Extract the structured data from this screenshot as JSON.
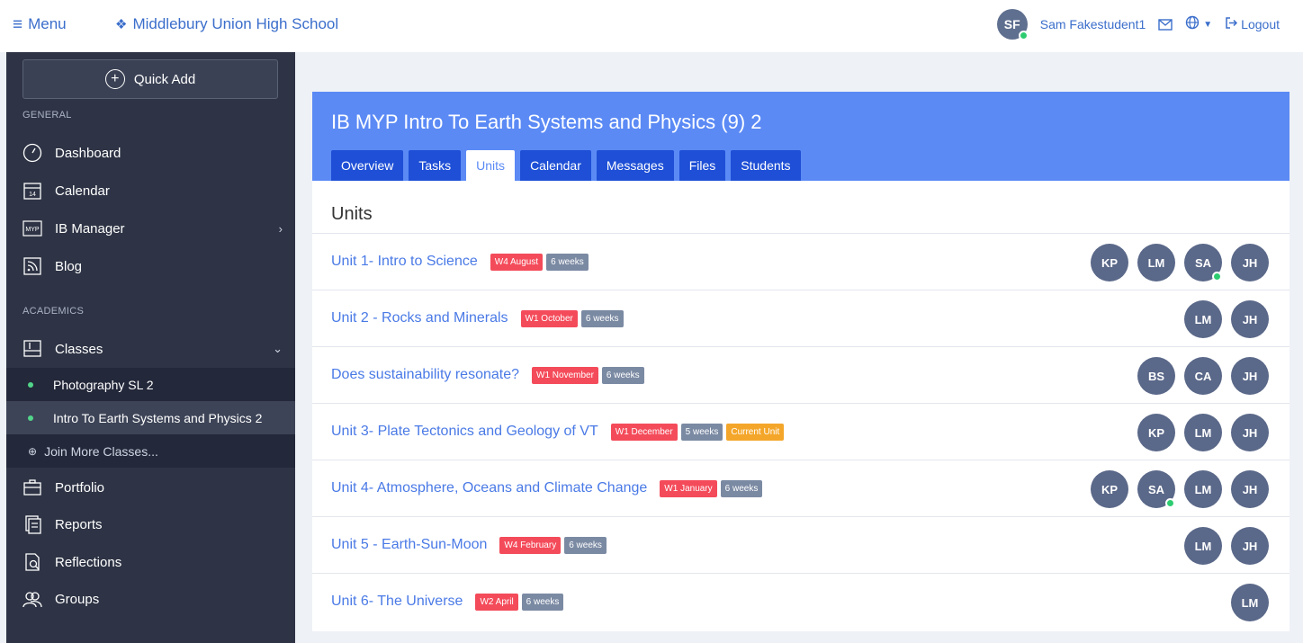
{
  "topbar": {
    "menu_label": "Menu",
    "school_name": "Middlebury Union High School",
    "user_initials": "SF",
    "user_name": "Sam Fakestudent1",
    "logout_label": "Logout"
  },
  "sidebar": {
    "quick_add_label": "Quick Add",
    "general_label": "GENERAL",
    "academics_label": "ACADEMICS",
    "items": {
      "dashboard": "Dashboard",
      "calendar": "Calendar",
      "calendar_icon_num": "14",
      "ib_manager": "IB Manager",
      "ib_icon_text": "MYP",
      "blog": "Blog",
      "classes": "Classes",
      "portfolio": "Portfolio",
      "reports": "Reports",
      "reflections": "Reflections",
      "groups": "Groups"
    },
    "classes": [
      "Photography SL 2",
      "Intro To Earth Systems and Physics 2"
    ],
    "join_label": "Join More Classes..."
  },
  "course": {
    "title": "IB MYP Intro To Earth Systems and Physics (9) 2",
    "tabs": [
      "Overview",
      "Tasks",
      "Units",
      "Calendar",
      "Messages",
      "Files",
      "Students"
    ],
    "active_tab": "Units",
    "units_heading": "Units"
  },
  "units": [
    {
      "title": "Unit 1- Intro to Science",
      "date": "W4 August",
      "weeks": "6 weeks",
      "current": "",
      "people": [
        {
          "i": "KP",
          "online": false
        },
        {
          "i": "LM",
          "online": false
        },
        {
          "i": "SA",
          "online": true
        },
        {
          "i": "JH",
          "online": false
        }
      ]
    },
    {
      "title": "Unit 2 - Rocks and Minerals",
      "date": "W1 October",
      "weeks": "6 weeks",
      "current": "",
      "people": [
        {
          "i": "LM",
          "online": false
        },
        {
          "i": "JH",
          "online": false
        }
      ]
    },
    {
      "title": "Does sustainability resonate?",
      "date": "W1 November",
      "weeks": "6 weeks",
      "current": "",
      "people": [
        {
          "i": "BS",
          "online": false
        },
        {
          "i": "CA",
          "online": false
        },
        {
          "i": "JH",
          "online": false
        }
      ]
    },
    {
      "title": "Unit 3- Plate Tectonics and Geology of VT",
      "date": "W1 December",
      "weeks": "5 weeks",
      "current": "Current Unit",
      "people": [
        {
          "i": "KP",
          "online": false
        },
        {
          "i": "LM",
          "online": false
        },
        {
          "i": "JH",
          "online": false
        }
      ]
    },
    {
      "title": "Unit 4- Atmosphere, Oceans and Climate Change",
      "date": "W1 January",
      "weeks": "6 weeks",
      "current": "",
      "people": [
        {
          "i": "KP",
          "online": false
        },
        {
          "i": "SA",
          "online": true
        },
        {
          "i": "LM",
          "online": false
        },
        {
          "i": "JH",
          "online": false
        }
      ]
    },
    {
      "title": "Unit 5 - Earth-Sun-Moon",
      "date": "W4 February",
      "weeks": "6 weeks",
      "current": "",
      "people": [
        {
          "i": "LM",
          "online": false
        },
        {
          "i": "JH",
          "online": false
        }
      ]
    },
    {
      "title": "Unit 6- The Universe",
      "date": "W2 April",
      "weeks": "6 weeks",
      "current": "",
      "people": [
        {
          "i": "LM",
          "online": false
        }
      ]
    }
  ],
  "colors": {
    "header_blue": "#5b8af5",
    "tab_blue": "#1e4fd6",
    "sidebar_bg": "#2e3445",
    "date_badge": "#f44b5a",
    "weeks_badge": "#7b8aa3",
    "current_badge": "#f4a62a",
    "online_dot": "#2ecc71"
  }
}
